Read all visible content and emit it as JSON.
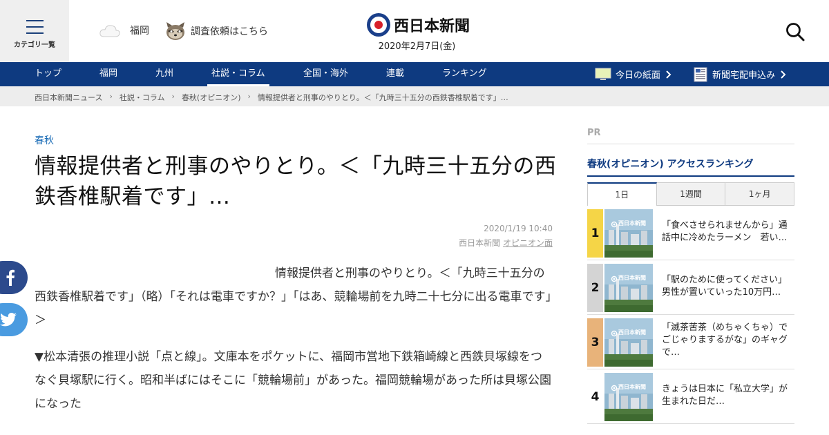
{
  "header": {
    "category_label": "カテゴリ一覧",
    "weather_city": "福岡",
    "survey_link": "調査依頼はこちら",
    "logo_text": "西日本新聞",
    "date": "2020年2月7日(金)"
  },
  "nav": {
    "items": [
      "トップ",
      "福岡",
      "九州",
      "社説・コラム",
      "全国・海外",
      "連載",
      "ランキング"
    ],
    "active": "社説・コラム",
    "todays_paper": "今日の紙面",
    "subscribe": "新聞宅配申込み"
  },
  "breadcrumb": [
    "西日本新聞ニュース",
    "社説・コラム",
    "春秋(オピニオン)",
    "情報提供者と刑事のやりとり。＜「九時三十五分の西鉄香椎駅着です」…"
  ],
  "article": {
    "category": "春秋",
    "title": "情報提供者と刑事のやりとり。＜「九時三十五分の西鉄香椎駅着です」…",
    "datetime": "2020/1/19 10:40",
    "source": "西日本新聞",
    "section_link": "オピニオン面",
    "paragraphs": [
      "情報提供者と刑事のやりとり。＜「九時三十五分の西鉄香椎駅着です」（略）「それは電車ですか？」「はあ、競輪場前を九時二十七分に出る電車です」＞",
      "▼松本清張の推理小説「点と線」。文庫本をポケットに、福岡市営地下鉄箱崎線と西鉄貝塚線をつなぐ貝塚駅に行く。昭和半ばにはそこに「競輪場前」があった。福岡競輪場があった所は貝塚公園になった"
    ]
  },
  "sidebar": {
    "pr_label": "PR",
    "ranking_title": "春秋(オピニオン) アクセスランキング",
    "tabs": [
      "1日",
      "1週間",
      "1ヶ月"
    ],
    "active_tab": "1日",
    "thumb_logo": "西日本新聞",
    "ranking": [
      {
        "rank": "1",
        "text": "「食べさせられませんから」通話中に冷めたラーメン　若い…",
        "color": "#f5d547"
      },
      {
        "rank": "2",
        "text": "「駅のために使ってください」男性が置いていった10万円…",
        "color": "#d4d4d4"
      },
      {
        "rank": "3",
        "text": "「滅茶苦茶（めちゃくちゃ）でごじゃりまするがな」のギャグで…",
        "color": "#e8b37a"
      },
      {
        "rank": "4",
        "text": "きょうは日本に「私立大学」が生まれた日だ…",
        "color": "#ffffff"
      }
    ]
  },
  "colors": {
    "nav_bg": "#0e3a80",
    "accent_link": "#1f6fb8",
    "facebook": "#2c4a8c",
    "twitter": "#4a9be0"
  }
}
